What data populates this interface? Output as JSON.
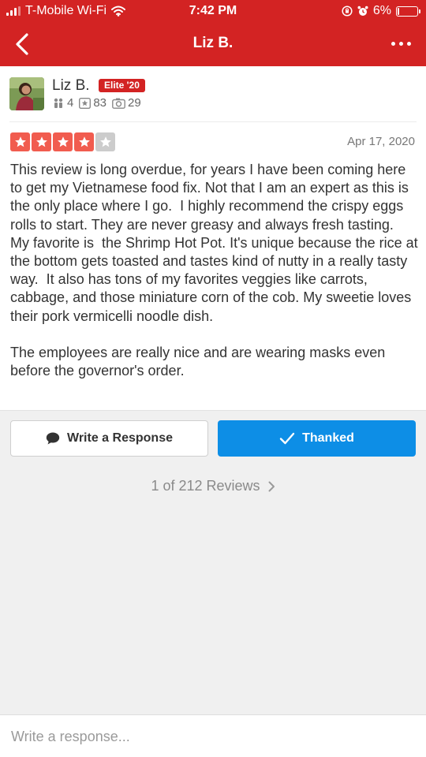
{
  "status_bar": {
    "carrier": "T-Mobile Wi-Fi",
    "time": "7:42 PM",
    "battery_percent": "6%",
    "battery_level": 0.06
  },
  "nav": {
    "title": "Liz B.",
    "back_icon": "chevron-left-icon",
    "more_icon": "more-dots-icon"
  },
  "user": {
    "name": "Liz B.",
    "badge": "Elite '20",
    "friends": "4",
    "reviews": "83",
    "photos": "29"
  },
  "review": {
    "rating": 4,
    "max_rating": 5,
    "date": "Apr 17, 2020",
    "text": "This review is long overdue, for years I have been coming here to get my Vietnamese food fix. Not that I am an expert as this is the only place where I go.  I highly recommend the crispy eggs rolls to start. They are never greasy and always fresh tasting.  My favorite is  the Shrimp Hot Pot. It's unique because the rice at the bottom gets toasted and tastes kind of nutty in a really tasty way.  It also has tons of my favorites veggies like carrots, cabbage, and those miniature corn of the cob. My sweetie loves their pork vermicelli noodle dish.\n\nThe employees are really nice and are wearing masks even before the governor's order."
  },
  "actions": {
    "respond_label": "Write a Response",
    "thanked_label": "Thanked"
  },
  "pager": {
    "label": "1 of 212 Reviews"
  },
  "response_bar": {
    "placeholder": "Write a response..."
  },
  "colors": {
    "brand_red": "#d32323",
    "star_red": "#f15c4f",
    "thanked_blue": "#0d8ee6"
  }
}
